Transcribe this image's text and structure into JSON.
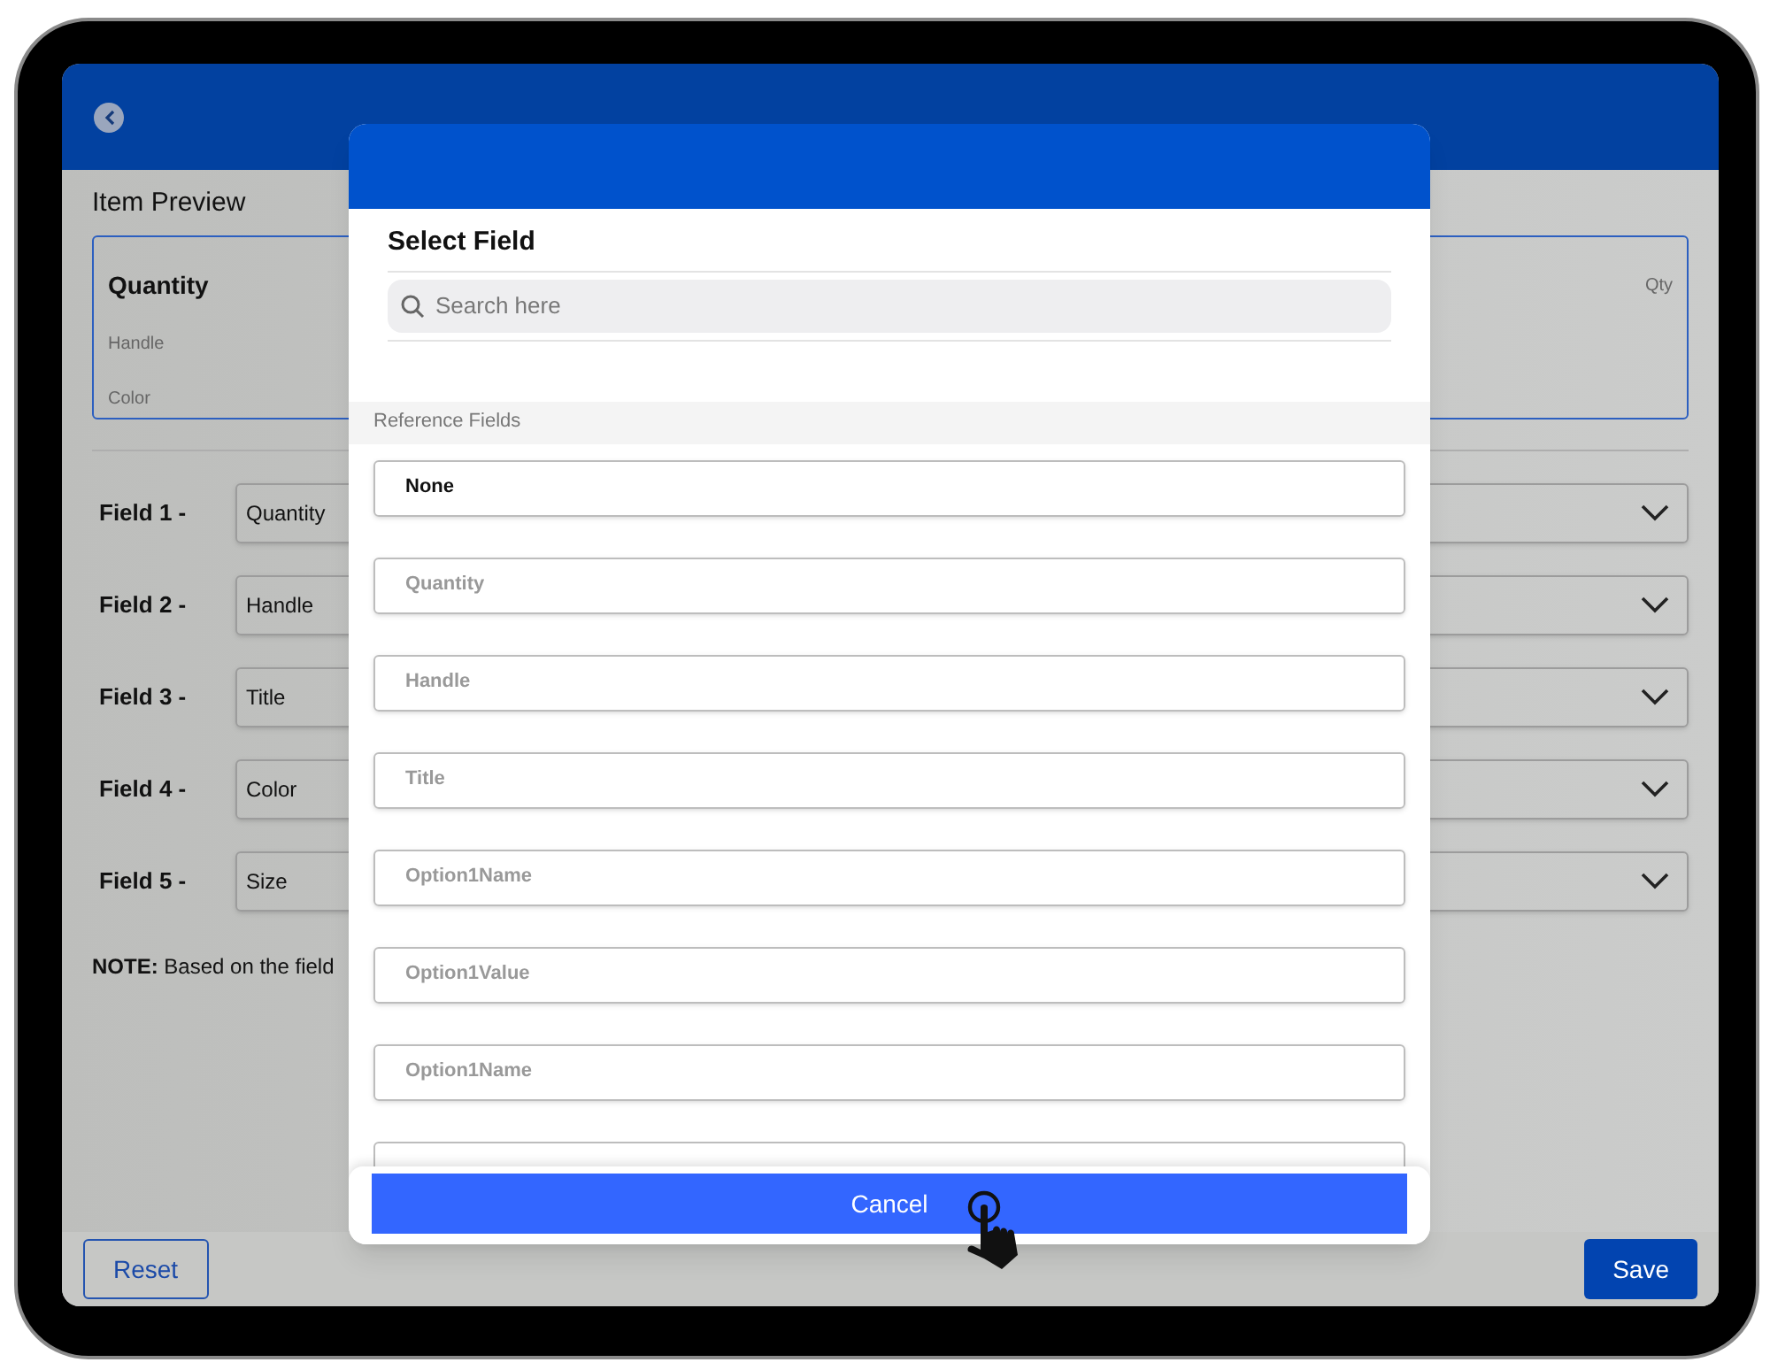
{
  "preview": {
    "heading": "Item Preview",
    "card": {
      "title": "Quantity",
      "lines": [
        "Handle",
        "Color"
      ],
      "right": "Qty"
    }
  },
  "fields": [
    {
      "label": "Field 1 -",
      "value": "Quantity"
    },
    {
      "label": "Field 2 -",
      "value": "Handle"
    },
    {
      "label": "Field 3 -",
      "value": "Title"
    },
    {
      "label": "Field 4 -",
      "value": "Color"
    },
    {
      "label": "Field 5 -",
      "value": "Size"
    }
  ],
  "note": "**NOTE:** Based on the field",
  "footer": {
    "reset": "Reset",
    "save": "Save"
  },
  "modal": {
    "title": "Select Field",
    "search": {
      "placeholder": "Search here"
    },
    "section": "Reference Fields",
    "options": [
      {
        "label": "None",
        "selected": true
      },
      {
        "label": "Quantity",
        "selected": false
      },
      {
        "label": "Handle",
        "selected": false
      },
      {
        "label": "Title",
        "selected": false
      },
      {
        "label": "Option1Name",
        "selected": false
      },
      {
        "label": "Option1Value",
        "selected": false
      },
      {
        "label": "Option1Name",
        "selected": false
      }
    ],
    "cancel": "Cancel"
  }
}
